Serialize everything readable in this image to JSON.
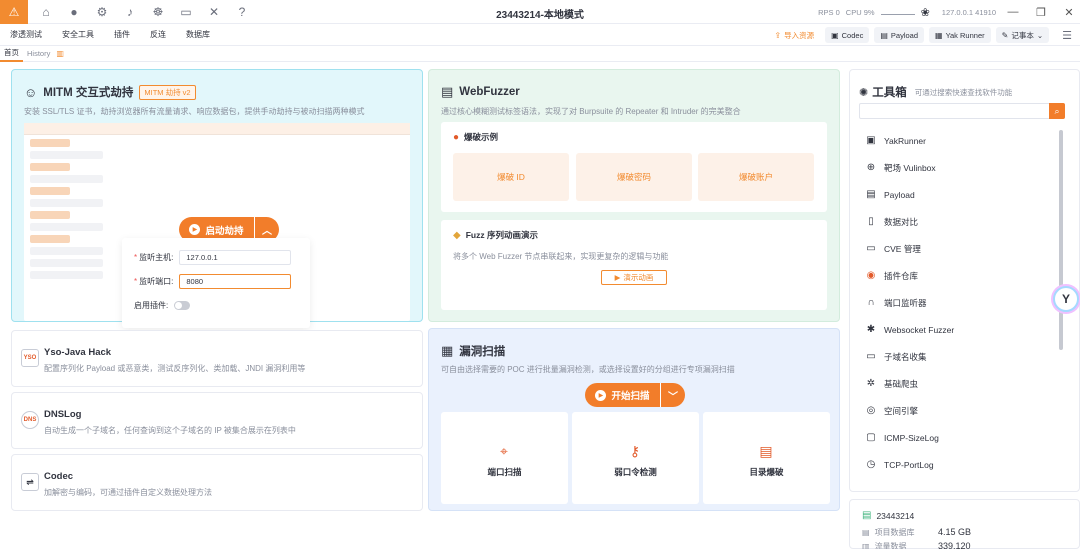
{
  "window": {
    "title": "23443214-本地模式",
    "rps": "RPS 0",
    "cpu": "CPU 9%",
    "ip_port": "127.0.0.1 41910"
  },
  "menu": {
    "items": [
      "渗透测试",
      "安全工具",
      "插件",
      "反连",
      "数据库"
    ],
    "right_buttons": [
      {
        "label": "导入资源",
        "icon": "import-icon"
      },
      {
        "label": "Codec",
        "icon": "codec-icon"
      },
      {
        "label": "Payload",
        "icon": "payload-icon"
      },
      {
        "label": "Yak Runner",
        "icon": "yak-runner-icon"
      },
      {
        "label": "记事本",
        "icon": "notepad-icon"
      }
    ]
  },
  "tabs": {
    "home": "首页",
    "history": "History"
  },
  "mitm": {
    "title": "MITM 交互式劫持",
    "badge": "MITM 劫持 v2",
    "desc": "安装 SSL/TLS 证书，劫持浏览器所有流量请求、响应数据包，提供手动劫持与被动扫描两种模式",
    "start_label": "启动劫持",
    "host_label": "监听主机:",
    "host_value": "127.0.0.1",
    "port_label": "监听端口:",
    "port_value": "8080",
    "plugin_label": "启用插件:"
  },
  "left_cards": [
    {
      "title": "Yso-Java Hack",
      "desc": "配置序列化 Payload 或恶意类，测试反序列化、类加载、JNDI 漏洞利用等"
    },
    {
      "title": "DNSLog",
      "desc": "自动生成一个子域名，任何查询到这个子域名的 IP 被集合展示在列表中"
    },
    {
      "title": "Codec",
      "desc": "加解密与编码，可通过插件自定义数据处理方法"
    }
  ],
  "webfuzzer": {
    "title": "WebFuzzer",
    "desc": "通过核心模糊测试标签语法，实现了对 Burpsuite 的 Repeater 和 Intruder 的完美整合",
    "examples_title": "爆破示例",
    "examples": [
      "爆破 ID",
      "爆破密码",
      "爆破账户"
    ],
    "seq_title": "Fuzz 序列动画演示",
    "seq_desc": "将多个 Web Fuzzer 节点串联起来，实现更复杂的逻辑与功能",
    "demo_label": "演示动画"
  },
  "scan": {
    "title": "漏洞扫描",
    "desc": "可自由选择需要的 POC 进行批量漏洞检测，或选择设置好的分组进行专项漏洞扫描",
    "start_label": "开始扫描",
    "tiles": [
      "端口扫描",
      "弱口令检测",
      "目录爆破"
    ]
  },
  "toolbox": {
    "title": "工具箱",
    "subtitle": "可通过搜索快速查找软件功能",
    "items": [
      {
        "label": "YakRunner",
        "icon": "terminal-icon"
      },
      {
        "label": "靶场 Vulinbox",
        "icon": "target-icon"
      },
      {
        "label": "Payload",
        "icon": "payload-icon"
      },
      {
        "label": "数据对比",
        "icon": "compare-icon"
      },
      {
        "label": "CVE 管理",
        "icon": "cve-icon"
      },
      {
        "label": "插件仓库",
        "icon": "plugin-store-icon"
      },
      {
        "label": "端口监听器",
        "icon": "headphones-icon"
      },
      {
        "label": "Websocket Fuzzer",
        "icon": "websocket-icon"
      },
      {
        "label": "子域名收集",
        "icon": "folder-icon"
      },
      {
        "label": "基础爬虫",
        "icon": "spider-icon"
      },
      {
        "label": "空间引擎",
        "icon": "globe-icon"
      },
      {
        "label": "ICMP-SizeLog",
        "icon": "icmp-icon"
      },
      {
        "label": "TCP-PortLog",
        "icon": "tcp-icon"
      }
    ]
  },
  "project": {
    "name": "23443214",
    "db_label": "项目数据库",
    "db_size": "4.15 GB",
    "flow_label": "流量数据",
    "flow_count": "339,120"
  }
}
